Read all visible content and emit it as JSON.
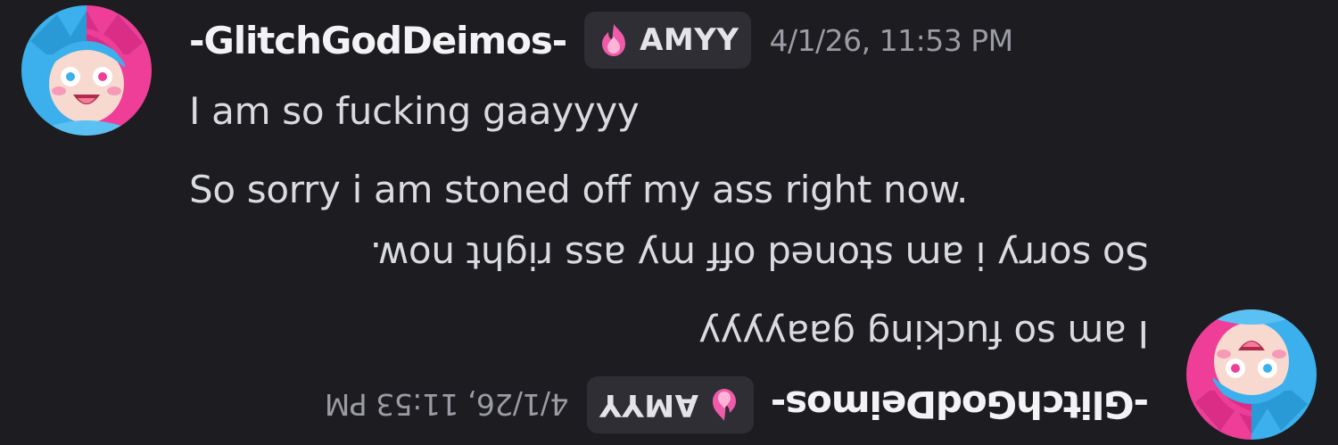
{
  "messages": [
    {
      "orientation": "upright",
      "author": "-GlitchGodDeimos-",
      "tag": {
        "icon": "pink-flame-icon",
        "label": "AMYY"
      },
      "timestamp": "4/1/26, 11:53 PM",
      "lines": [
        "I am so fucking gaayyyy",
        "So sorry i am stoned off my ass right now."
      ]
    },
    {
      "orientation": "rotated-180",
      "author": "-GlitchGodDeimos-",
      "tag": {
        "icon": "pink-flame-icon",
        "label": "AMYY"
      },
      "timestamp": "4/1/26, 11:53 PM",
      "lines": [
        "I am so fucking gaayyyy",
        "So sorry i am stoned off my ass right now."
      ]
    }
  ],
  "colors": {
    "background": "#1d1d21",
    "username": "#f3f3f5",
    "text": "#dadbe0",
    "timestamp": "#9a9ba3",
    "tag_bg": "#2e2e34",
    "avatar_pink": "#ef3e97",
    "avatar_blue": "#3bb0ec"
  }
}
